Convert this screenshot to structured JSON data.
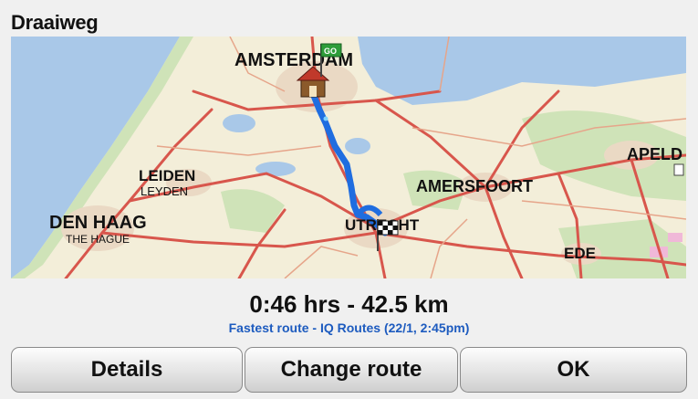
{
  "header": {
    "title": "Draaiweg"
  },
  "map": {
    "labels": {
      "amsterdam": "AMSTERDAM",
      "leiden": "LEIDEN",
      "leyden": "LEYDEN",
      "den_haag": "DEN HAAG",
      "the_hague": "THE HAGUE",
      "utrecht": "UTRECHT",
      "amersfoort": "AMERSFOORT",
      "apeld": "APELD",
      "ede": "EDE"
    },
    "start_marker_text": "GO",
    "route_color": "#1f6de0",
    "water_color": "#a9c8e8",
    "road_color": "#d8564c"
  },
  "route": {
    "summary": "0:46 hrs - 42.5 km",
    "detail": "Fastest route - IQ Routes (22/1,  2:45pm)"
  },
  "buttons": {
    "details": "Details",
    "change_route": "Change route",
    "ok": "OK"
  }
}
